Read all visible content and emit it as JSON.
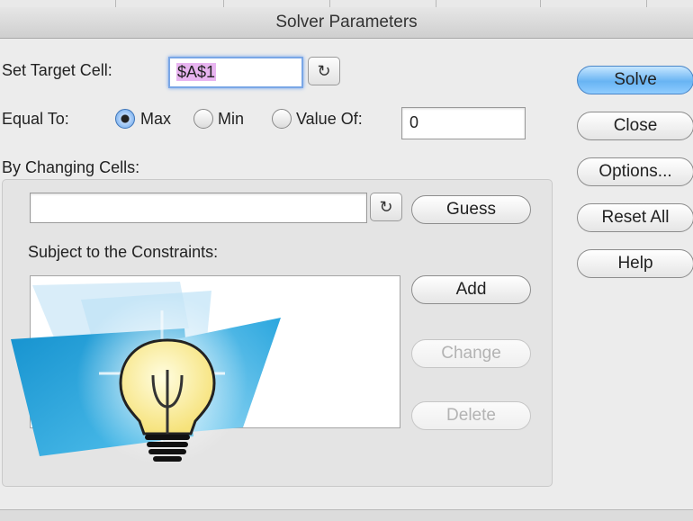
{
  "window": {
    "title": "Solver Parameters"
  },
  "target": {
    "label": "Set Target Cell:",
    "value": "$A$1"
  },
  "equal_to": {
    "label": "Equal To:",
    "options": [
      {
        "label": "Max",
        "selected": true
      },
      {
        "label": "Min",
        "selected": false
      },
      {
        "label": "Value Of:",
        "selected": false
      }
    ],
    "value_of": "0"
  },
  "changing_cells": {
    "label": "By Changing Cells:",
    "value": ""
  },
  "constraints": {
    "label": "Subject to the Constraints:",
    "items": []
  },
  "buttons": {
    "solve": "Solve",
    "close": "Close",
    "options": "Options...",
    "reset_all": "Reset All",
    "help": "Help",
    "guess": "Guess",
    "add": "Add",
    "change": "Change",
    "delete": "Delete"
  },
  "icons": {
    "collapse_dialog": "collapse-dialog-icon",
    "solver_logo": "lightbulb-icon"
  },
  "colors": {
    "default_button": "#68b4f3",
    "selection_highlight": "#e8b4f0",
    "focus_ring": "#7aa7e6",
    "logo_blue": "#1ba3dc"
  }
}
